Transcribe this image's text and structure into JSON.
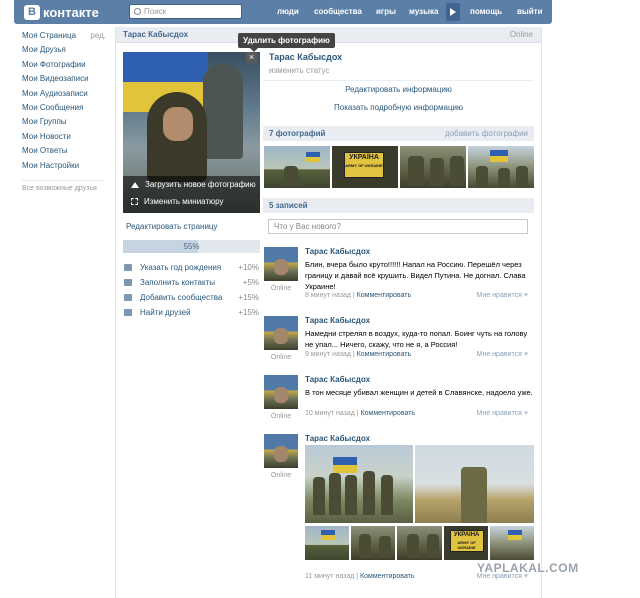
{
  "header": {
    "logo_badge": "В",
    "logo_text": "контакте",
    "search_placeholder": "Поиск",
    "nav": [
      "люди",
      "сообщества",
      "игры",
      "музыка",
      "помощь",
      "выйти"
    ],
    "bg_color": "#5B7FA6"
  },
  "sidebar": {
    "edit_label": "ред.",
    "items": [
      {
        "label": "Моя Страница"
      },
      {
        "label": "Мои Друзья"
      },
      {
        "label": "Мои Фотографии"
      },
      {
        "label": "Мои Видеозаписи"
      },
      {
        "label": "Мои Аудиозаписи"
      },
      {
        "label": "Мои Сообщения"
      },
      {
        "label": "Мои Группы"
      },
      {
        "label": "Мои Новости"
      },
      {
        "label": "Мои Ответы"
      },
      {
        "label": "Мои Настройки"
      }
    ],
    "hint": "Все возможные друзья"
  },
  "profile": {
    "title_name": "Тарас Кабысдох",
    "online": "Online",
    "name": "Тарас Кабысдох",
    "status_placeholder": "изменить статус",
    "upload_photo": "Загрузить новое фотографию",
    "change_thumb": "Изменить миниатюру",
    "tooltip": "Удалить фотографию",
    "close": "×",
    "edit_info": "Редактировать информацию",
    "show_info": "Показать подробную информацию",
    "edit_page": "Редактировать страницу",
    "completion": {
      "label": "55%",
      "value": 0.55
    },
    "tasks": [
      {
        "label": "Указать год рождения",
        "value": "+10%"
      },
      {
        "label": "Заполнить контакты",
        "value": "+5%"
      },
      {
        "label": "Добавить сообщества",
        "value": "+15%"
      },
      {
        "label": "Найти друзей",
        "value": "+15%"
      }
    ]
  },
  "photos_section": {
    "title": "7 фотографий",
    "action": "добавить фотографии",
    "patch_text": "УКРАЇНА",
    "patch_sub": "ARMY OF UKRAINE"
  },
  "wall": {
    "title": "5 записей",
    "new_post_placeholder": "Что у Вас нового?",
    "posts": [
      {
        "author": "Тарас Кабысдох",
        "online": "Online",
        "text": "Блин, вчера было круто!!!!!! Напал на Россию. Перешёл через границу и давай всё крушить. Видел Путина. Не догнал. Слава Украине!",
        "time": "8 минут назад",
        "comment": "Комментировать",
        "like": "Мне нравится"
      },
      {
        "author": "Тарас Кабысдох",
        "online": "Online",
        "text": "Намедни стрелял в воздух, куда-то попал. Боинг чуть на голову не упал... Ничего, скажу, что не я, а Россия!",
        "time": "9 минут назад",
        "comment": "Комментировать",
        "like": "Мне нравится"
      },
      {
        "author": "Тарас Кабысдох",
        "online": "Online",
        "text": "В тон месяце убивал женщин и детей в Славянске, надоело уже.",
        "time": "10 минут назад",
        "comment": "Комментировать",
        "like": "Мне нравится"
      },
      {
        "author": "Тарас Кабысдох",
        "online": "Online",
        "time": "11 минут назад",
        "comment": "Комментировать",
        "like": "Мне нравится"
      }
    ]
  },
  "watermark": "YAPLAKAL.COM"
}
